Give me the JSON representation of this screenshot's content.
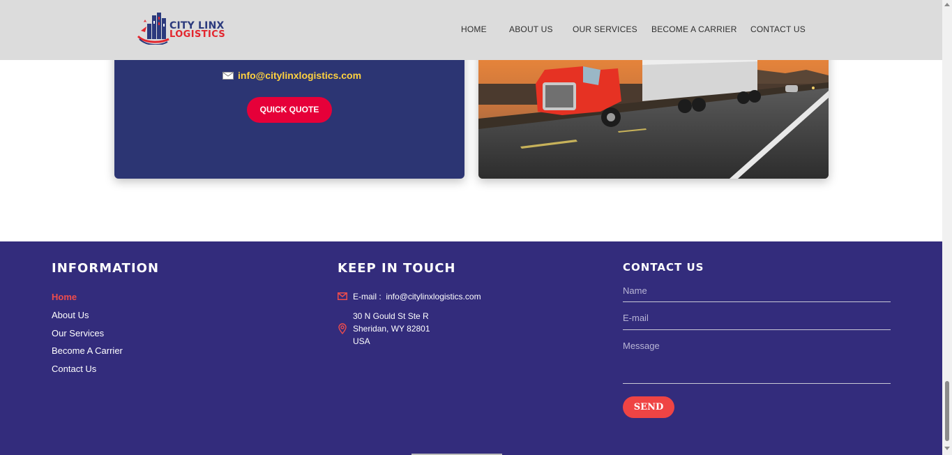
{
  "brand": {
    "line1": "CITY LINX",
    "line2": "LOGISTICS"
  },
  "nav": {
    "items": [
      {
        "label": "HOME"
      },
      {
        "label": "ABOUT US"
      },
      {
        "label": "OUR SERVICES"
      },
      {
        "label": "BECOME A CARRIER"
      },
      {
        "label": "CONTACT US"
      }
    ]
  },
  "promo": {
    "email": "info@citylinxlogistics.com",
    "quote_button": "QUICK QUOTE"
  },
  "footer": {
    "information": {
      "heading": "INFORMATION",
      "links": [
        {
          "label": "Home",
          "active": true
        },
        {
          "label": "About Us"
        },
        {
          "label": "Our Services"
        },
        {
          "label": "Become A Carrier"
        },
        {
          "label": "Contact Us"
        }
      ]
    },
    "keep_in_touch": {
      "heading": "KEEP IN TOUCH",
      "email_label": "E-mail :",
      "email": "info@citylinxlogistics.com",
      "address_line1": "30 N Gould St Ste R",
      "address_line2": "Sheridan, WY 82801",
      "address_line3": "USA"
    },
    "contact": {
      "heading": "CONTACT US",
      "name_placeholder": "Name",
      "email_placeholder": "E-mail",
      "message_placeholder": "Message",
      "send_button": "SEND"
    }
  },
  "colors": {
    "accent_red": "#e60039",
    "navy_card": "#2c3573",
    "footer_bg": "#332c7c",
    "email_yellow": "#ffd23f"
  }
}
